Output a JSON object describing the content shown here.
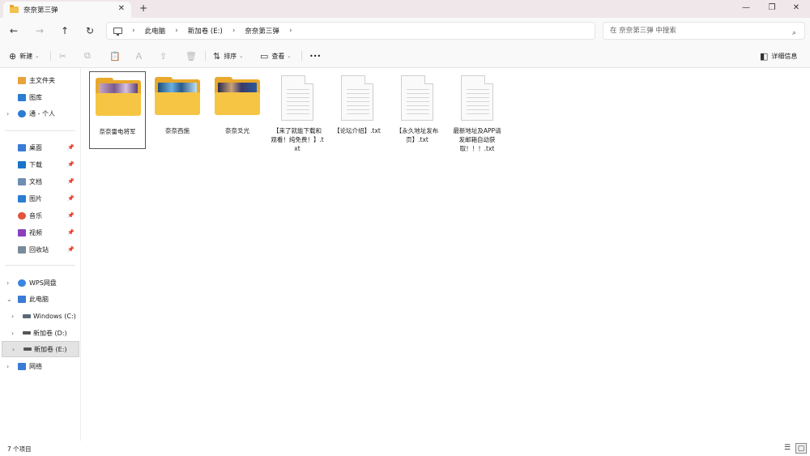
{
  "window": {
    "tab_title": "奈奈第三弹",
    "tab_close": "✕",
    "new_tab": "+",
    "minimize": "—",
    "restore": "❐",
    "close": "✕"
  },
  "nav": {
    "back": "←",
    "forward": "→",
    "up": "↑",
    "refresh": "↻"
  },
  "address": {
    "crumbs": [
      "此电脑",
      "新加卷 (E:)",
      "奈奈第三弹"
    ],
    "sep": "›"
  },
  "search": {
    "placeholder": "在 奈奈第三弹 中搜索",
    "icon": "⌕"
  },
  "toolbar": {
    "new_label": "新建",
    "sort_label": "排序",
    "view_label": "查看",
    "more": "•••",
    "details_label": "详细信息",
    "icons": {
      "new": "⊕",
      "cut": "✂",
      "copy": "⧉",
      "paste": "📋",
      "rename": "Ａ",
      "share": "⇪",
      "delete": "🗑",
      "sort": "⇅",
      "view": "▭",
      "details": "◧",
      "caret": "⌄"
    }
  },
  "sidebar": {
    "quick": [
      {
        "label": "主文件夹",
        "color": "#e8a33d"
      },
      {
        "label": "图库",
        "color": "#2b7cd3"
      },
      {
        "label": "通 - 个人",
        "color": "#2b7cd3"
      }
    ],
    "pinned": [
      {
        "label": "桌面",
        "color": "#3a7bd5"
      },
      {
        "label": "下载",
        "color": "#1a73c9"
      },
      {
        "label": "文档",
        "color": "#6d8fb3"
      },
      {
        "label": "图片",
        "color": "#2b7cd3"
      },
      {
        "label": "音乐",
        "color": "#e0543b"
      },
      {
        "label": "视频",
        "color": "#8a3fbf"
      },
      {
        "label": "回收站",
        "color": "#7a8a99"
      }
    ],
    "devices": [
      {
        "label": "WPS网盘",
        "color": "#3a86e0"
      },
      {
        "label": "此电脑",
        "color": "#3a7bd5"
      },
      {
        "label": "Windows (C:)",
        "color": "#5a6a7a"
      },
      {
        "label": "新加卷 (D:)",
        "color": "#555555"
      },
      {
        "label": "新加卷 (E:)",
        "color": "#555555"
      },
      {
        "label": "网络",
        "color": "#3a7bd5"
      }
    ],
    "chev_right": "›",
    "chev_down": "⌄",
    "pin": "📌"
  },
  "files": [
    {
      "name": "奈奈雷电将军",
      "type": "folder",
      "thumb": "#7a5a8c"
    },
    {
      "name": "奈奈西施",
      "type": "folder",
      "thumb": "#4a8ab8"
    },
    {
      "name": "奈奈爻光",
      "type": "folder",
      "thumb": "#3a3a6a"
    },
    {
      "name": "【来了就能下载和观看！纯免费！】.txt",
      "type": "txt"
    },
    {
      "name": "【论坛介绍】.txt",
      "type": "txt"
    },
    {
      "name": "【永久地址发布页】.txt",
      "type": "txt"
    },
    {
      "name": "最新地址及APP请发邮箱自动获取！！！.txt",
      "type": "txt"
    }
  ],
  "status": {
    "count": "7 个项目",
    "list_icon": "☰",
    "tiles_icon": "▢"
  }
}
